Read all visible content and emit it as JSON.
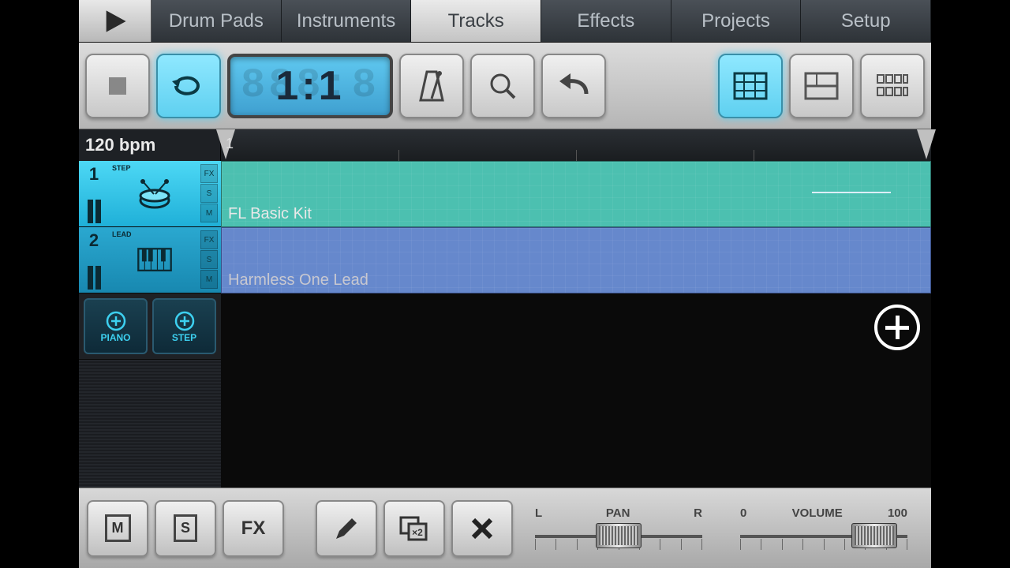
{
  "tabs": {
    "drum_pads": "Drum Pads",
    "instruments": "Instruments",
    "tracks": "Tracks",
    "effects": "Effects",
    "projects": "Projects",
    "setup": "Setup",
    "active": "tracks"
  },
  "transport": {
    "position_display": "1:1"
  },
  "tempo": {
    "display": "120 bpm",
    "ruler_start": "1"
  },
  "tracks_list": [
    {
      "num": "1",
      "type": "STEP",
      "clip_name": "FL Basic Kit",
      "instrument": "drum",
      "selected": true
    },
    {
      "num": "2",
      "type": "LEAD",
      "clip_name": "Harmless One Lead",
      "instrument": "keys",
      "selected": false
    }
  ],
  "add_buttons": {
    "piano": "PIANO",
    "step": "STEP"
  },
  "track_flags": {
    "fx": "FX",
    "s": "S",
    "m": "M"
  },
  "bottom": {
    "mute": "M",
    "solo": "S",
    "fx": "FX",
    "pan": {
      "left": "L",
      "label": "PAN",
      "right": "R",
      "value": 50
    },
    "volume": {
      "min": "0",
      "label": "VOLUME",
      "max": "100",
      "value": 80
    }
  }
}
